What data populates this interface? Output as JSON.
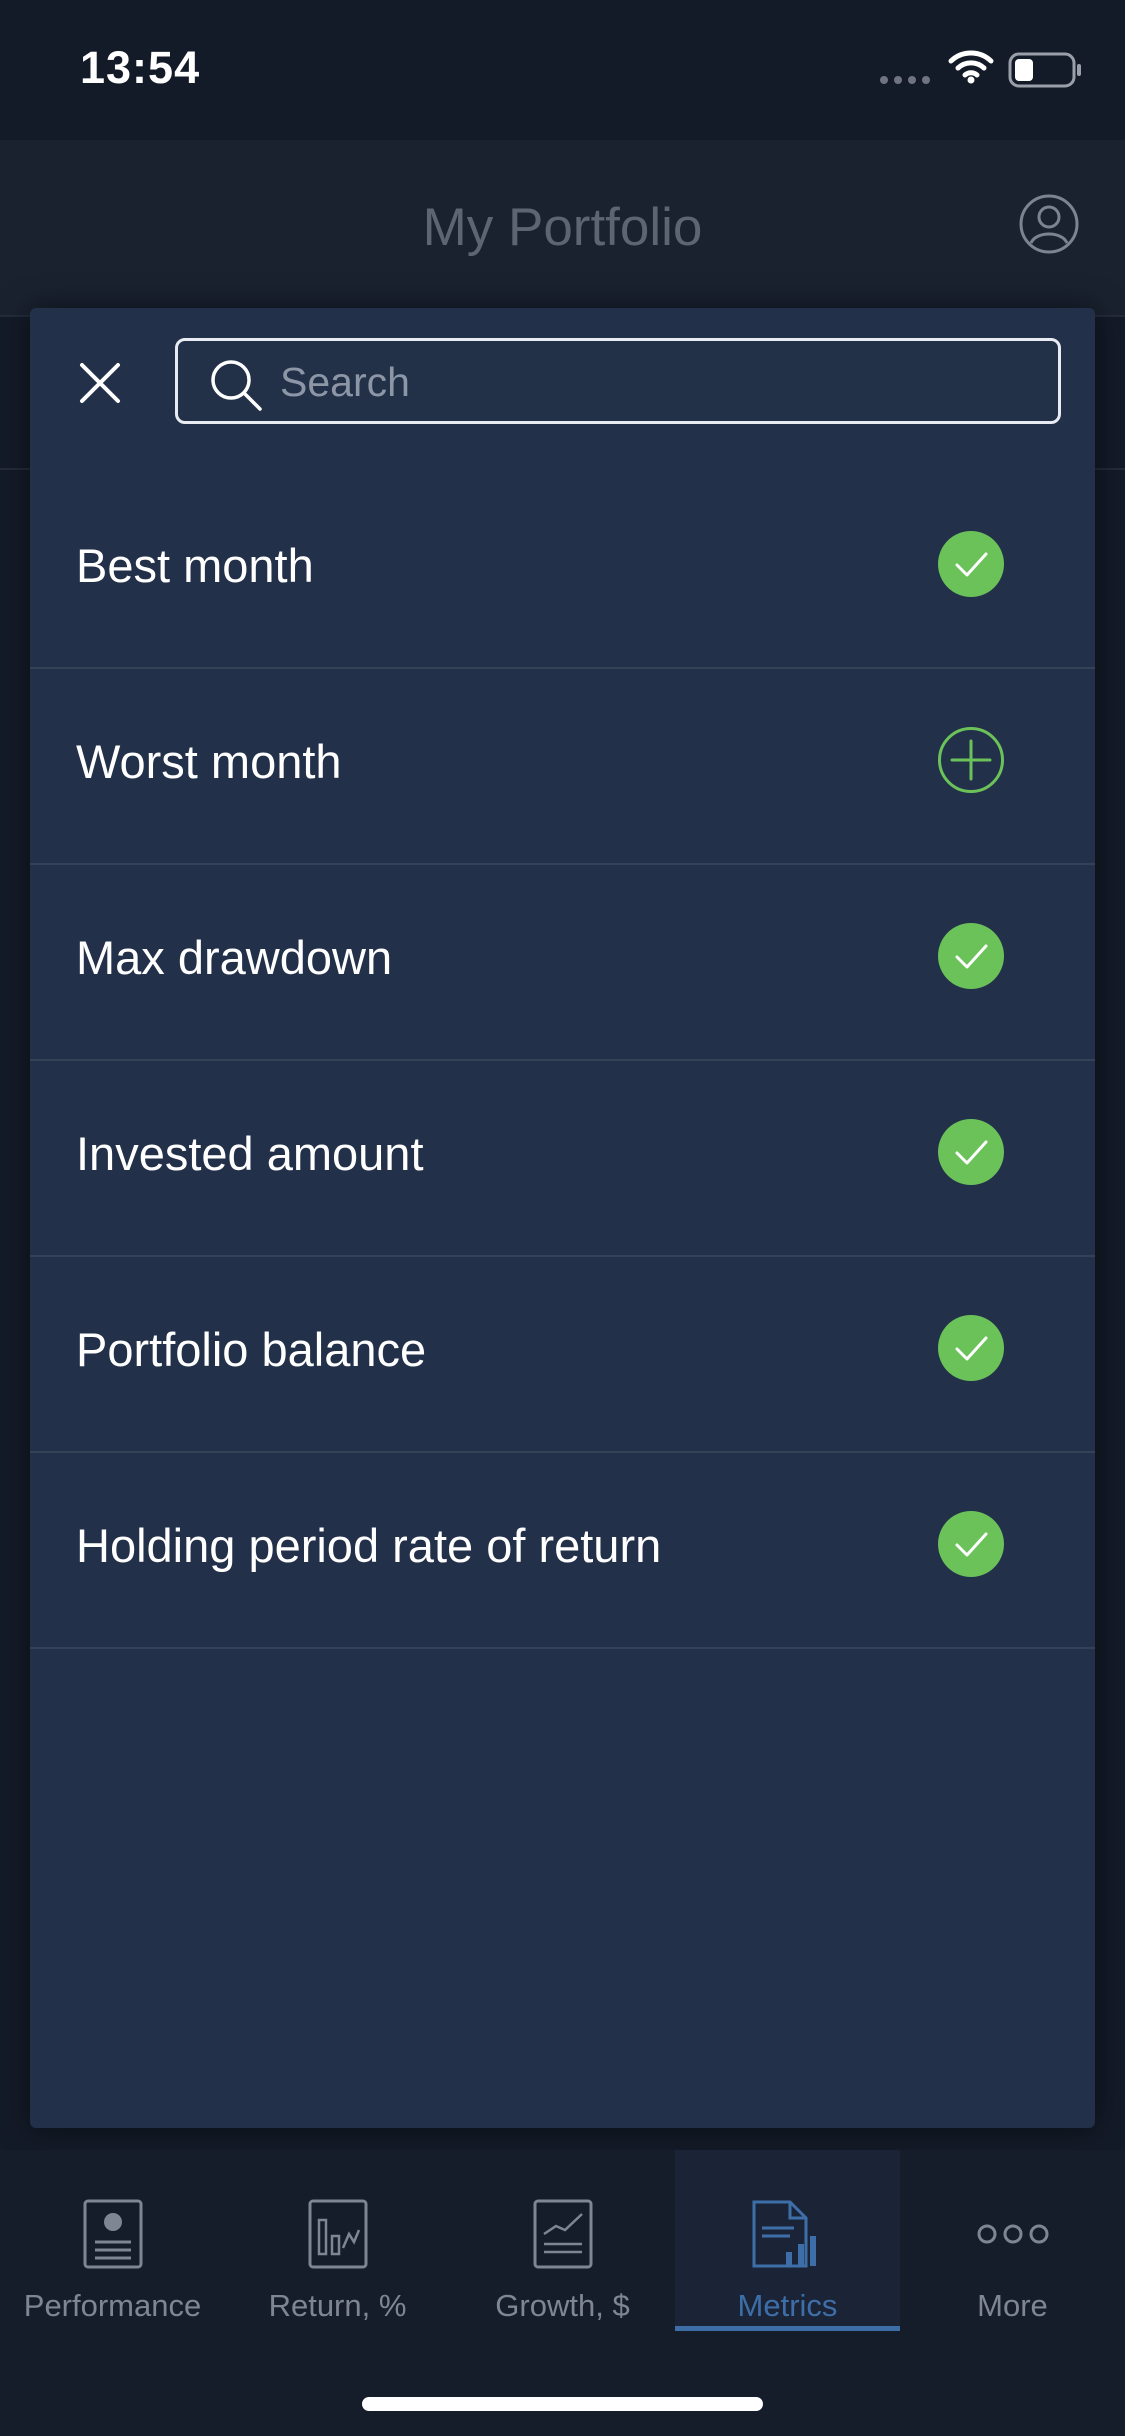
{
  "status_bar": {
    "time": "13:54"
  },
  "header": {
    "title": "My Portfolio"
  },
  "search": {
    "placeholder": "Search",
    "value": ""
  },
  "metrics": [
    {
      "label": "Best month",
      "state": "selected"
    },
    {
      "label": "Worst month",
      "state": "add"
    },
    {
      "label": "Max drawdown",
      "state": "selected"
    },
    {
      "label": "Invested amount",
      "state": "selected"
    },
    {
      "label": "Portfolio balance",
      "state": "selected"
    },
    {
      "label": "Holding period rate of return",
      "state": "selected"
    }
  ],
  "tabs": [
    {
      "label": "Performance",
      "icon": "performance-icon",
      "active": false
    },
    {
      "label": "Return, %",
      "icon": "return-icon",
      "active": false
    },
    {
      "label": "Growth, $",
      "icon": "growth-icon",
      "active": false
    },
    {
      "label": "Metrics",
      "icon": "metrics-icon",
      "active": true
    },
    {
      "label": "More",
      "icon": "more-icon",
      "active": false
    }
  ],
  "colors": {
    "accent_green": "#6ac259",
    "active_tab": "#3e6ea8",
    "sheet_bg": "#233049"
  }
}
